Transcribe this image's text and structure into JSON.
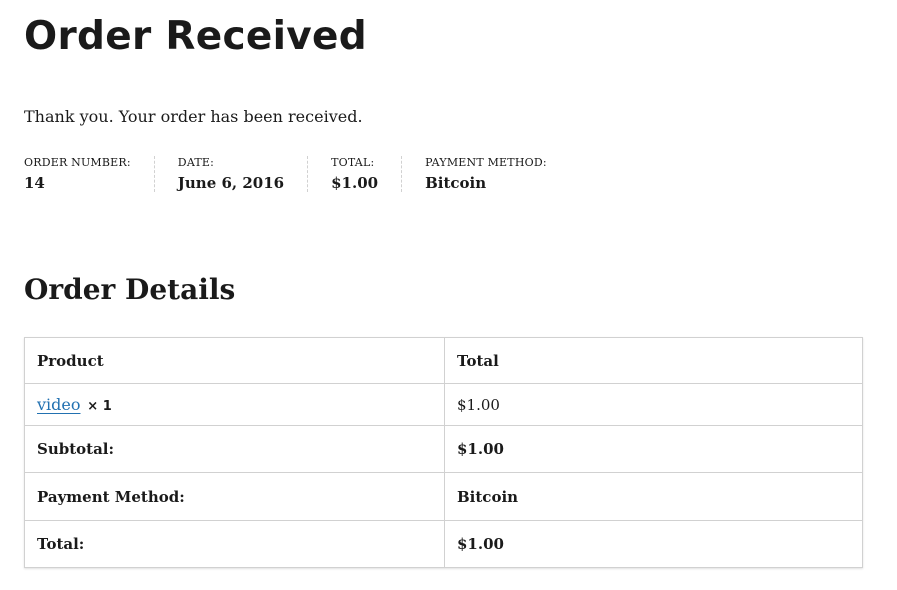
{
  "page_title": "Order Received",
  "thank_you": "Thank you. Your order has been received.",
  "overview": {
    "order_number_label": "ORDER NUMBER:",
    "order_number": "14",
    "date_label": "DATE:",
    "date": "June 6, 2016",
    "total_label": "TOTAL:",
    "total": "$1.00",
    "payment_method_label": "PAYMENT METHOD:",
    "payment_method": "Bitcoin"
  },
  "details": {
    "title": "Order Details",
    "headers": [
      "Product",
      "Total"
    ],
    "item": {
      "product_name": "video",
      "quantity": "× 1",
      "total": "$1.00"
    },
    "rows": [
      {
        "label": "Subtotal:",
        "value": "$1.00"
      },
      {
        "label": "Payment Method:",
        "value": "Bitcoin"
      },
      {
        "label": "Total:",
        "value": "$1.00"
      }
    ]
  },
  "colors": {
    "text": "#1a1a1a",
    "link": "#2271b1",
    "border": "#d1d1d1"
  }
}
